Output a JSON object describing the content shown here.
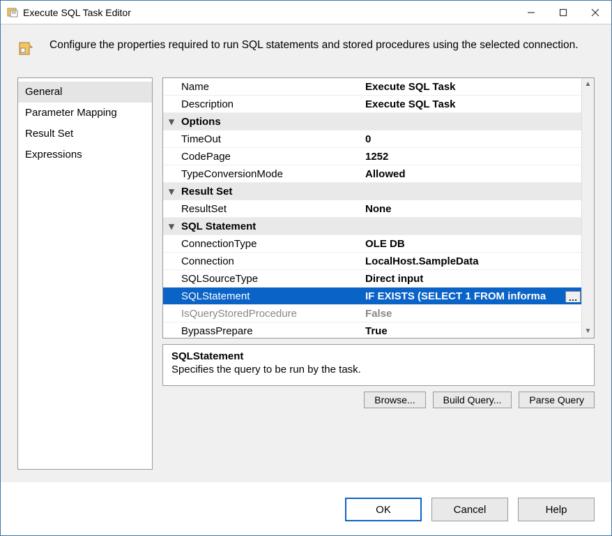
{
  "window": {
    "title": "Execute SQL Task Editor"
  },
  "header": {
    "text": "Configure the properties required to run SQL statements and stored procedures using the selected connection."
  },
  "sidebar": {
    "items": [
      {
        "label": "General",
        "selected": true
      },
      {
        "label": "Parameter Mapping"
      },
      {
        "label": "Result Set"
      },
      {
        "label": "Expressions"
      }
    ]
  },
  "grid": {
    "rows": [
      {
        "type": "prop",
        "name": "Name",
        "value": "Execute SQL Task"
      },
      {
        "type": "prop",
        "name": "Description",
        "value": "Execute SQL Task"
      },
      {
        "type": "cat",
        "name": "Options"
      },
      {
        "type": "prop",
        "name": "TimeOut",
        "value": "0"
      },
      {
        "type": "prop",
        "name": "CodePage",
        "value": "1252"
      },
      {
        "type": "prop",
        "name": "TypeConversionMode",
        "value": "Allowed"
      },
      {
        "type": "cat",
        "name": "Result Set"
      },
      {
        "type": "prop",
        "name": "ResultSet",
        "value": "None"
      },
      {
        "type": "cat",
        "name": "SQL Statement"
      },
      {
        "type": "prop",
        "name": "ConnectionType",
        "value": "OLE DB"
      },
      {
        "type": "prop",
        "name": "Connection",
        "value": "LocalHost.SampleData"
      },
      {
        "type": "prop",
        "name": "SQLSourceType",
        "value": "Direct input"
      },
      {
        "type": "prop",
        "name": "SQLStatement",
        "value": "IF EXISTS (SELECT 1 FROM informa",
        "selected": true,
        "ellipsis": true
      },
      {
        "type": "prop",
        "name": "IsQueryStoredProcedure",
        "value": "False",
        "disabled": true
      },
      {
        "type": "prop",
        "name": "BypassPrepare",
        "value": "True"
      }
    ]
  },
  "desc": {
    "title": "SQLStatement",
    "body": "Specifies the query to be run by the task."
  },
  "midbuttons": {
    "browse": "Browse...",
    "build": "Build Query...",
    "parse": "Parse Query"
  },
  "buttons": {
    "ok": "OK",
    "cancel": "Cancel",
    "help": "Help"
  }
}
